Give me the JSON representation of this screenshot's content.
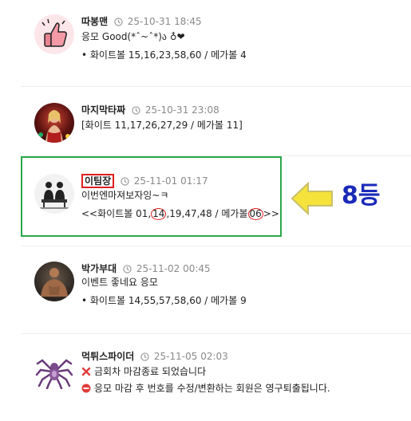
{
  "comments": [
    {
      "author": "따봉맨",
      "timestamp": "25-10-31 18:45",
      "lines": [
        "응모 Good(*ˆ~ˆ*)ა ♁❤",
        "• 화이트볼 15,16,23,58,60 / 메가볼 4"
      ]
    },
    {
      "author": "마지막타짜",
      "timestamp": "25-10-31 23:08",
      "lines": [
        "[화이트 11,17,26,27,29 / 메가볼 11]"
      ]
    },
    {
      "author": "이팀장",
      "timestamp": "25-11-01 01:17",
      "lines": [
        "이번엔마져보자잉~ㅋ"
      ],
      "numbers_prefix": "<<화이트볼 01,",
      "numbers_circled_1": "14",
      "numbers_mid": ",19,47,48 / 메가볼",
      "numbers_circled_2": "06",
      "numbers_suffix": ">>"
    },
    {
      "author": "박가부대",
      "timestamp": "25-11-02 00:45",
      "lines": [
        "이벤트 좋네요 응모",
        "• 화이트볼 14,55,57,58,60 / 메가볼 9"
      ]
    },
    {
      "author": "먹튀스파이더",
      "timestamp": "25-11-05 02:03",
      "lines": [
        "금회차 마감종료 되었습니다",
        "응모 마감 후 번호를 수정/변환하는 회원은 영구퇴출됩니다."
      ]
    }
  ],
  "annotation": {
    "rank_label": "8등",
    "arrow_color": "#f5e23a",
    "label_color": "#1a2ab8"
  },
  "colors": {
    "highlight_box": "#2aa84a",
    "mark_red": "#e02020"
  }
}
